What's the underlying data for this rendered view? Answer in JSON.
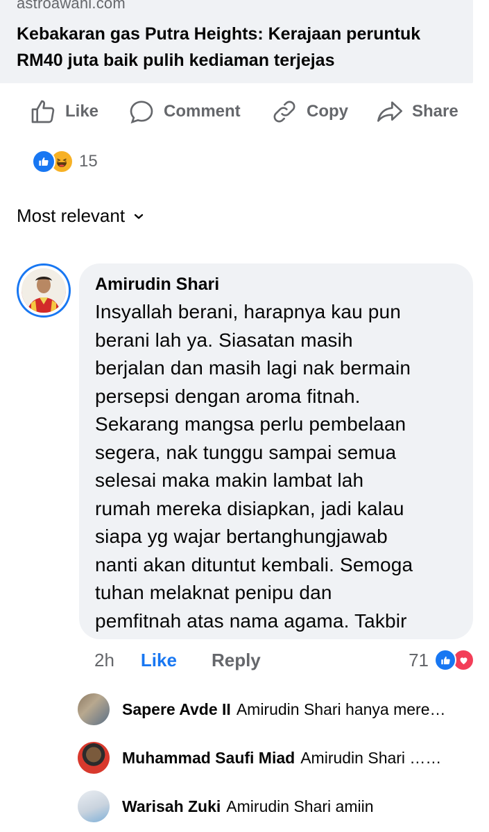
{
  "link_preview": {
    "domain": "astroawani.com",
    "title": "Kebakaran gas Putra Heights: Kerajaan peruntuk RM40 juta baik pulih kediaman terjejas"
  },
  "actions": {
    "like": "Like",
    "comment": "Comment",
    "copy": "Copy",
    "share": "Share"
  },
  "reactions": {
    "icons": [
      "like",
      "haha"
    ],
    "count": "15"
  },
  "sort": {
    "label": "Most relevant",
    "icon": "chevron-down-icon"
  },
  "comment": {
    "author": "Amirudin Shari",
    "text": "Insyallah berani, harapnya kau pun\nberani lah ya. Siasatan masih\nberjalan dan masih lagi nak bermain\npersepsi dengan aroma fitnah.\nSekarang mangsa perlu pembelaan\nsegera, nak tunggu sampai semua\nselesai maka makin lambat lah\nrumah mereka disiapkan, jadi kalau\nsiapa yg wajar bertanghungjawab\nnanti akan dituntut kembali. Semoga\ntuhan melaknat penipu dan\npemfitnah atas nama agama. Takbir",
    "time": "2h",
    "like_label": "Like",
    "reply_label": "Reply",
    "reaction_count": "71",
    "reaction_icons": [
      "like",
      "love"
    ],
    "colors": {
      "like_blue": "#1877f2",
      "love_red": "#f33e58"
    }
  },
  "replies": [
    {
      "name": "Sapere Avde II",
      "text": "Amirudin Shari hanya mere…"
    },
    {
      "name": "Muhammad Saufi Miad",
      "text": "Amirudin Shari ……"
    },
    {
      "name": "Warisah Zuki",
      "text": "Amirudin Shari amiin"
    }
  ]
}
